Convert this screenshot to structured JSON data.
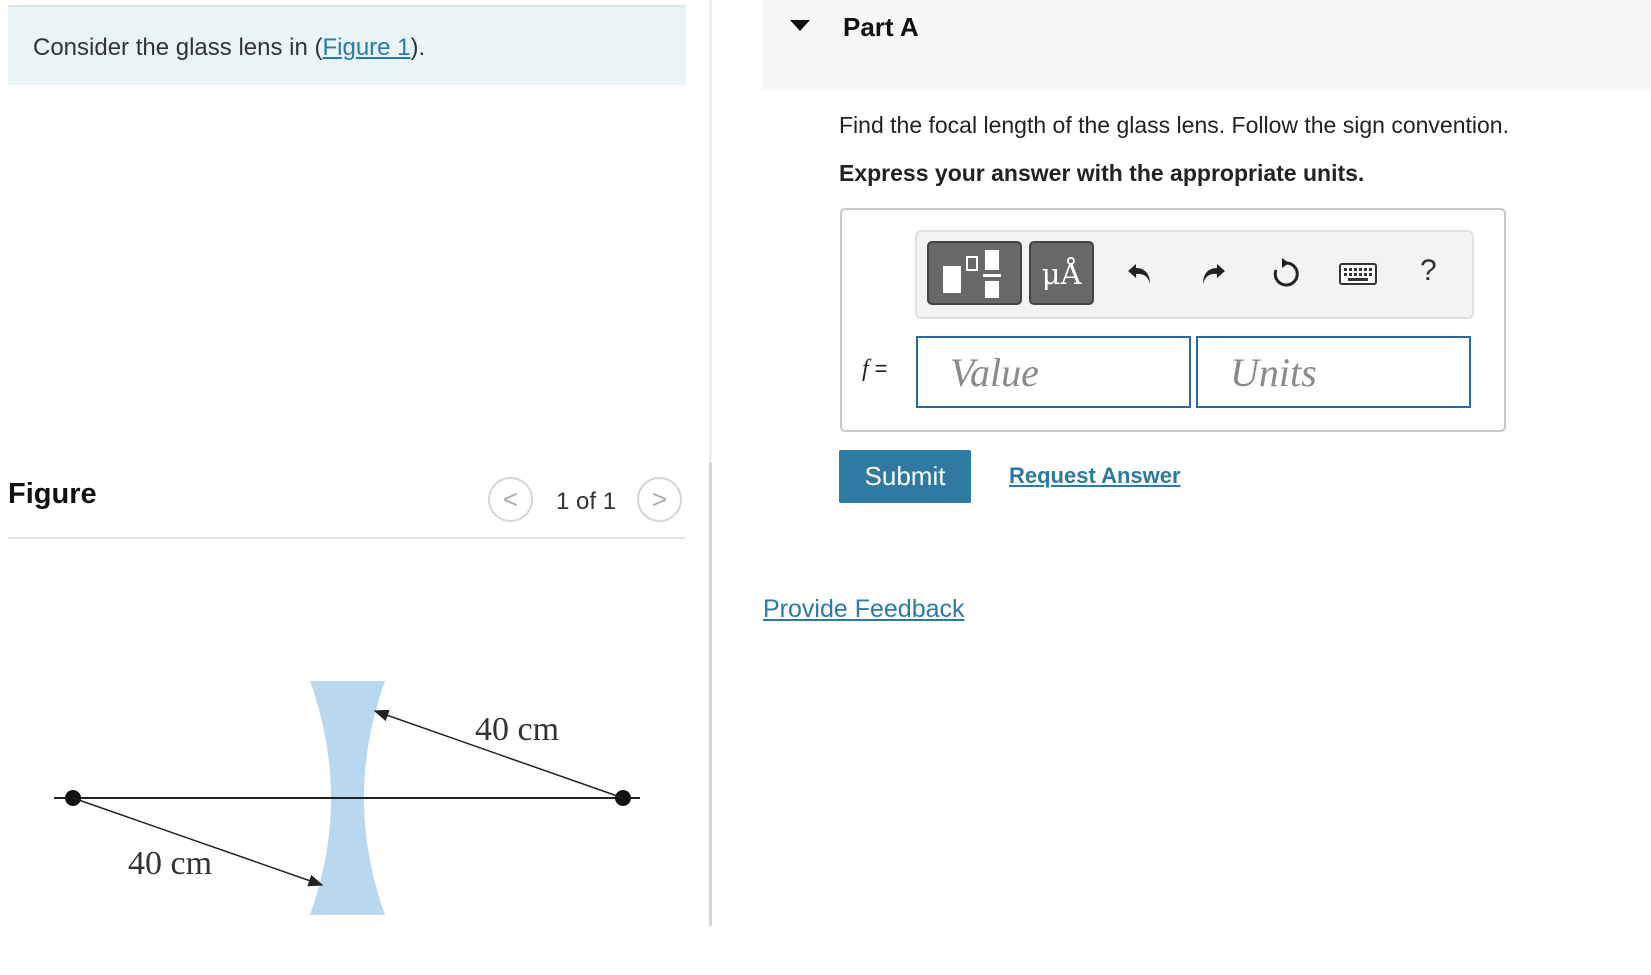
{
  "intro": {
    "prefix": "Consider the glass lens in (",
    "link": "Figure 1",
    "suffix": ")."
  },
  "figure": {
    "title": "Figure",
    "pager": {
      "prev": "<",
      "next": ">",
      "count": "1 of 1"
    },
    "labels": {
      "upper_distance": "40 cm",
      "lower_distance": "40 cm"
    },
    "lens_color": "#b9d7ee"
  },
  "part": {
    "title": "Part A",
    "question": "Find the focal length of the glass lens. Follow the sign convention.",
    "instruction": "Express your answer with the appropriate units."
  },
  "toolbar": {
    "units_label": "μÅ",
    "help_label": "?",
    "icons": [
      "templates-icon",
      "units-icon",
      "undo-icon",
      "redo-icon",
      "reset-icon",
      "keyboard-icon",
      "help-icon"
    ]
  },
  "answer": {
    "variable": "f",
    "equals": "=",
    "value_placeholder": "Value",
    "units_placeholder": "Units"
  },
  "actions": {
    "submit": "Submit",
    "request_answer": "Request Answer",
    "feedback": "Provide Feedback"
  },
  "colors": {
    "accent": "#2f7aa2",
    "link": "#2a7aa3",
    "intro_bg": "#e8f4f6",
    "field_border": "#2b6a9a"
  }
}
